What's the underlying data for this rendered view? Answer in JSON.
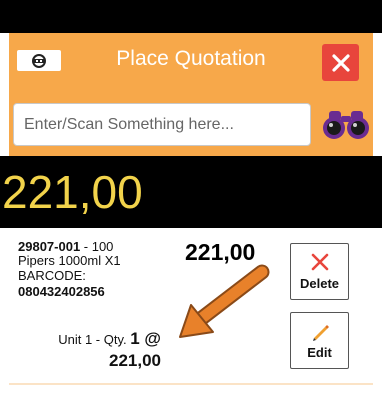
{
  "header": {
    "title": "Place Quotation",
    "logo_icon": "cash-register-icon",
    "close_icon": "close-icon",
    "colors": {
      "header_bg": "#F7A84A",
      "close_bg": "#E8453C"
    }
  },
  "search": {
    "placeholder": "Enter/Scan Something here...",
    "value": "",
    "scan_icon": "binoculars-icon"
  },
  "total": {
    "value": "221,00",
    "color": "#F2D34B"
  },
  "item": {
    "code": "29807-001",
    "code_suffix": " - 100",
    "description": "Pipers 1000ml X1",
    "barcode_label": "BARCODE:",
    "barcode": "080432402856",
    "price": "221,00",
    "unit_prefix": "Unit 1 - Qty. ",
    "qty": "1",
    "at": " @",
    "unit_price": "221,00"
  },
  "actions": {
    "delete_label": "Delete",
    "delete_icon": "close-icon",
    "edit_label": "Edit",
    "edit_icon": "pencil-icon"
  },
  "annotation": {
    "arrow_icon": "arrow-icon",
    "arrow_color": "#E8812A"
  }
}
